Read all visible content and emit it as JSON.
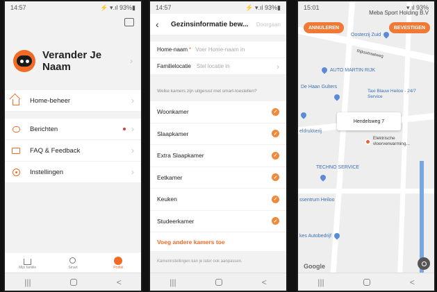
{
  "screen1": {
    "status_time": "14:57",
    "status_right": "⚡ ▾.ıl 93%▮",
    "profile_name": "Verander Je Naam",
    "menu_top": [
      {
        "label": "Home-beheer"
      }
    ],
    "menu_main": [
      {
        "label": "Berichten"
      },
      {
        "label": "FAQ & Feedback"
      },
      {
        "label": "Instellingen"
      }
    ],
    "tabs": [
      {
        "label": "Mijn familie"
      },
      {
        "label": "Smart"
      },
      {
        "label": "Profiel"
      }
    ],
    "nav": {
      "recents": "|||",
      "back": "<"
    },
    "colors": {
      "accent": "#f06b25",
      "notification": "#e53935"
    }
  },
  "screen2": {
    "status_time": "14:57",
    "status_right": "⚡ ▾.ıl 93%▮",
    "title": "Gezinsinformatie bew...",
    "done": "Doorgaan",
    "home_name_label": "Home-naam",
    "required_mark": "*",
    "home_name_placeholder": "Voer Home-naam in",
    "location_label": "Familielocatie",
    "location_value": "Stel locatie in",
    "question": "Welke kamers zijn uitgerust met smart-toestellen?",
    "rooms": [
      {
        "label": "Woonkamer"
      },
      {
        "label": "Slaapkamer"
      },
      {
        "label": "Extra Slaapkamer"
      },
      {
        "label": "Eetkamer"
      },
      {
        "label": "Keuken"
      },
      {
        "label": "Studeerkamer"
      }
    ],
    "check_mark": "✓",
    "add_rooms": "Voeg andere kamers toe",
    "footnote": "Kamerinstellingen kan je later ook aanpassen.",
    "nav": {
      "recents": "|||",
      "back": "<"
    }
  },
  "screen3": {
    "status_time": "15:01",
    "status_right": "▾.ıl 93%",
    "cancel": "ANNULEREN",
    "confirm": "BEVESTIGEN",
    "map_title": "Meba Sport Holding B.V",
    "pois": [
      {
        "label": "Oosterzij Zuid"
      },
      {
        "label": "AUTO MARTIN RIJK"
      },
      {
        "label": "De Haan Gulters"
      },
      {
        "label": "Taxi Blauw Heiloo - 24/7 Service"
      },
      {
        "label": "eldrukkerij"
      },
      {
        "label": "Elektrische vloerverwarming..."
      },
      {
        "label": "TECHNO SERVICE"
      },
      {
        "label": "ssentrum Heiloo"
      },
      {
        "label": "kes Autobedrijf"
      }
    ],
    "street_label": "Rijksstraatweg",
    "address": "Hendelsweg 7",
    "google": "Google",
    "nav": {
      "recents": "|||",
      "back": "<"
    }
  }
}
